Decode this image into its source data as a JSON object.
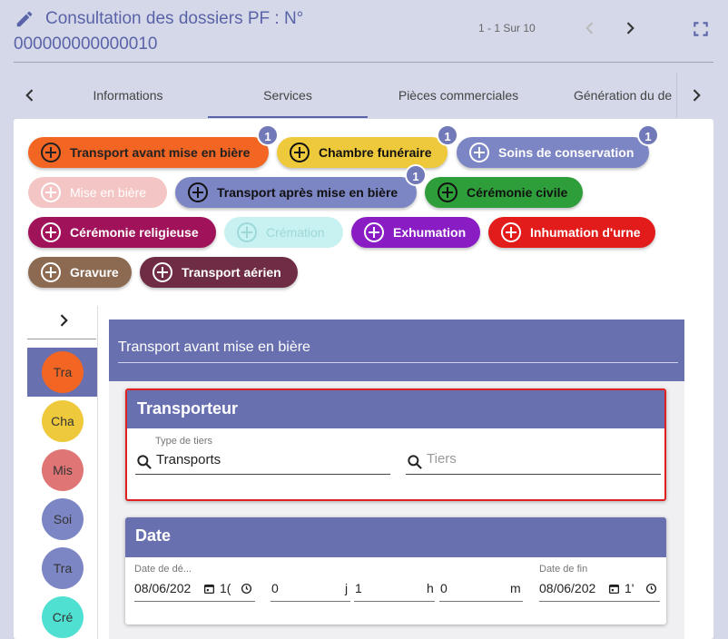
{
  "header": {
    "title": "Consultation des dossiers PF : N°",
    "number": "000000000000010",
    "pager": "1 - 1 Sur 10"
  },
  "tabs": [
    {
      "label": "Informations"
    },
    {
      "label": "Services"
    },
    {
      "label": "Pièces commerciales"
    },
    {
      "label": "Génération du de"
    }
  ],
  "chips": [
    {
      "label": "Transport avant mise en bière",
      "badge": "1",
      "color": "#f26522"
    },
    {
      "label": "Chambre funéraire",
      "badge": "1",
      "color": "#eec93c"
    },
    {
      "label": "Soins de conservation",
      "badge": "1",
      "color": "#7d86c4"
    },
    {
      "label": "Mise en bière",
      "color": "#f4c5c5"
    },
    {
      "label": "Transport après mise en bière",
      "badge": "1",
      "color": "#7d86c4"
    },
    {
      "label": "Cérémonie civile",
      "color": "#2e9e3a"
    },
    {
      "label": "Cérémonie religieuse",
      "color": "#a0125a"
    },
    {
      "label": "Crémation",
      "color": "#c8f1f1"
    },
    {
      "label": "Exhumation",
      "color": "#8a1cc4"
    },
    {
      "label": "Inhumation d'urne",
      "color": "#e21b1b"
    },
    {
      "label": "Gravure",
      "color": "#8c6a52"
    },
    {
      "label": "Transport aérien",
      "color": "#6e2d44"
    }
  ],
  "sidebar": [
    {
      "label": "Tra",
      "color": "#f26522"
    },
    {
      "label": "Cha",
      "color": "#eec93c"
    },
    {
      "label": "Mis",
      "color": "#e07575"
    },
    {
      "label": "Soi",
      "color": "#7d86c4"
    },
    {
      "label": "Tra",
      "color": "#7d86c4"
    },
    {
      "label": "Cré",
      "color": "#4fe0d2"
    }
  ],
  "panel": {
    "title": "Transport avant mise en bière"
  },
  "transporteur": {
    "title": "Transporteur",
    "type_label": "Type de tiers",
    "type_value": "Transports",
    "tiers_placeholder": "Tiers"
  },
  "date": {
    "title": "Date",
    "start_label": "Date de dé...",
    "start_value": "08/06/202",
    "start_time": "1(",
    "days": "0",
    "days_unit": "j",
    "hours": "1",
    "hours_unit": "h",
    "minutes": "0",
    "minutes_unit": "m",
    "end_label": "Date de fin",
    "end_value": "08/06/202",
    "end_time": "1'"
  }
}
